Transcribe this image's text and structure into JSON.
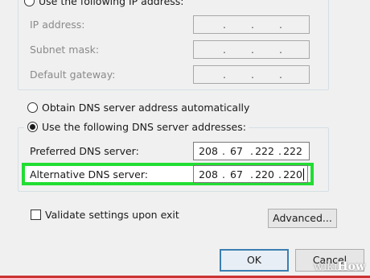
{
  "ip_section": {
    "use_following_label": "Use the following IP address:",
    "ip_address_label": "IP address:",
    "subnet_mask_label": "Subnet mask:",
    "default_gateway_label": "Default gateway:",
    "empty_dot": "."
  },
  "dns_section": {
    "obtain_auto_label": "Obtain DNS server address automatically",
    "use_following_label": "Use the following DNS server addresses:",
    "preferred_label": "Preferred DNS server:",
    "alternate_label": "Alternative DNS server:",
    "preferred_value": [
      "208",
      "67",
      "222",
      "222"
    ],
    "alternate_value": [
      "208",
      "67",
      "220",
      "220"
    ],
    "dot": "."
  },
  "footer": {
    "validate_label": "Validate settings upon exit",
    "advanced_button": "Advanced...",
    "ok_button": "OK",
    "cancel_button": "Cancel"
  },
  "watermark": {
    "prefix": "wiki",
    "suffix": "How"
  },
  "colors": {
    "highlight": "#22dd33",
    "default_button_border": "#3c7fb1"
  }
}
